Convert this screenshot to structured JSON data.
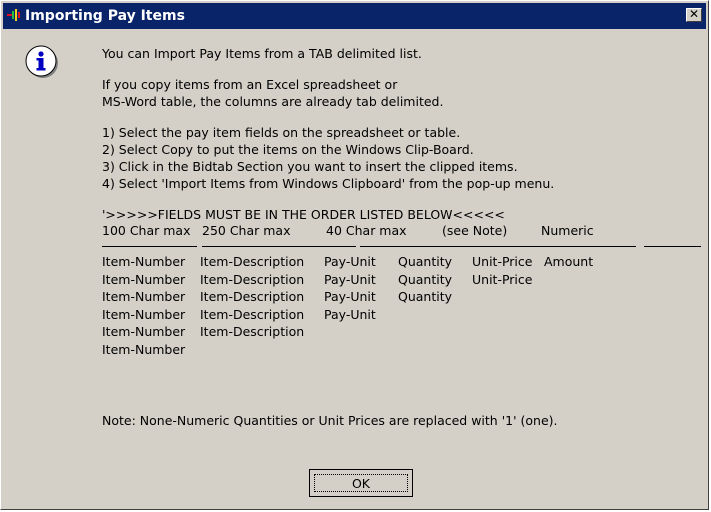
{
  "window": {
    "title": "Importing Pay Items",
    "close_label": "✕"
  },
  "icons": {
    "info": "info-icon",
    "app": "app-icon"
  },
  "intro": "You can Import Pay Items from a TAB delimited list.",
  "copy_lines": [
    "If you copy items from an Excel spreadsheet or",
    "MS-Word table, the columns are already tab delimited."
  ],
  "steps": [
    "1) Select the pay item fields on the spreadsheet or table.",
    "2) Select Copy to put the items on the Windows Clip-Board.",
    "3) Click in the Bidtab Section you want to insert the clipped items.",
    "4) Select 'Import Items from Windows Clipboard' from the pop-up menu."
  ],
  "order_notice": "'>>>>>FIELDS MUST BE IN THE ORDER LISTED BELOW<<<<<",
  "column_limits": [
    "100 Char max",
    "250 Char max",
    "40 Char max",
    "(see Note)",
    "Numeric"
  ],
  "field_rows": [
    [
      "Item-Number",
      "Item-Description",
      "Pay-Unit",
      "Quantity",
      "Unit-Price",
      "Amount"
    ],
    [
      "Item-Number",
      "Item-Description",
      "Pay-Unit",
      "Quantity",
      "Unit-Price"
    ],
    [
      "Item-Number",
      "Item-Description",
      "Pay-Unit",
      "Quantity"
    ],
    [
      "Item-Number",
      "Item-Description",
      "Pay-Unit"
    ],
    [
      "Item-Number",
      "Item-Description"
    ],
    [
      "Item-Number"
    ]
  ],
  "note": "Note: None-Numeric Quantities or Unit Prices are replaced with '1' (one).",
  "buttons": {
    "ok": "OK"
  }
}
